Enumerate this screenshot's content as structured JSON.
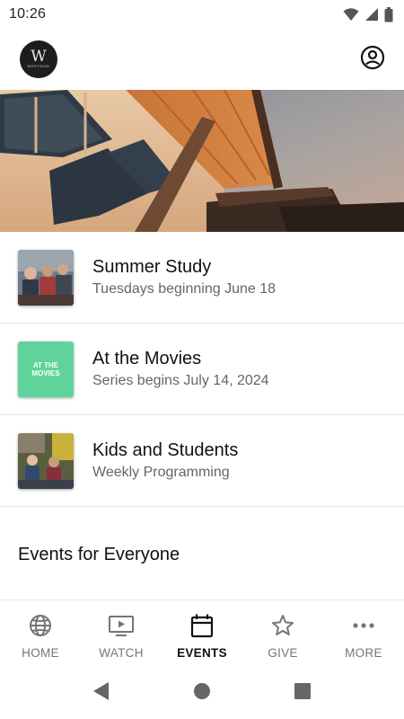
{
  "status_bar": {
    "time": "10:26",
    "icons": [
      "wifi-icon",
      "signal-icon",
      "battery-icon"
    ]
  },
  "header": {
    "logo_letter": "W",
    "logo_text": "WESTSIDE",
    "profile_icon": "account-circle-icon"
  },
  "hero": {
    "description_icon": "building-photo"
  },
  "items": [
    {
      "title": "Summer Study",
      "subtitle": "Tuesdays beginning June 18"
    },
    {
      "title": "At the Movies",
      "subtitle": "Series begins July 14, 2024",
      "thumb_text": "AT THE MOVIES"
    },
    {
      "title": "Kids and Students",
      "subtitle": "Weekly Programming"
    }
  ],
  "section": {
    "title": "Events for Everyone"
  },
  "tabs": [
    {
      "label": "HOME",
      "icon": "globe-icon",
      "active": false
    },
    {
      "label": "WATCH",
      "icon": "tv-play-icon",
      "active": false
    },
    {
      "label": "EVENTS",
      "icon": "calendar-icon",
      "active": true
    },
    {
      "label": "GIVE",
      "icon": "star-icon",
      "active": false
    },
    {
      "label": "MORE",
      "icon": "more-dots-icon",
      "active": false
    }
  ],
  "nav": {
    "icons": [
      "back-icon",
      "home-icon",
      "recents-icon"
    ]
  },
  "colors": {
    "active_tab": "#111111",
    "inactive_tab": "#757575",
    "divider": "#e6e6e6",
    "movies_thumb_bg": "#5fd39b"
  }
}
